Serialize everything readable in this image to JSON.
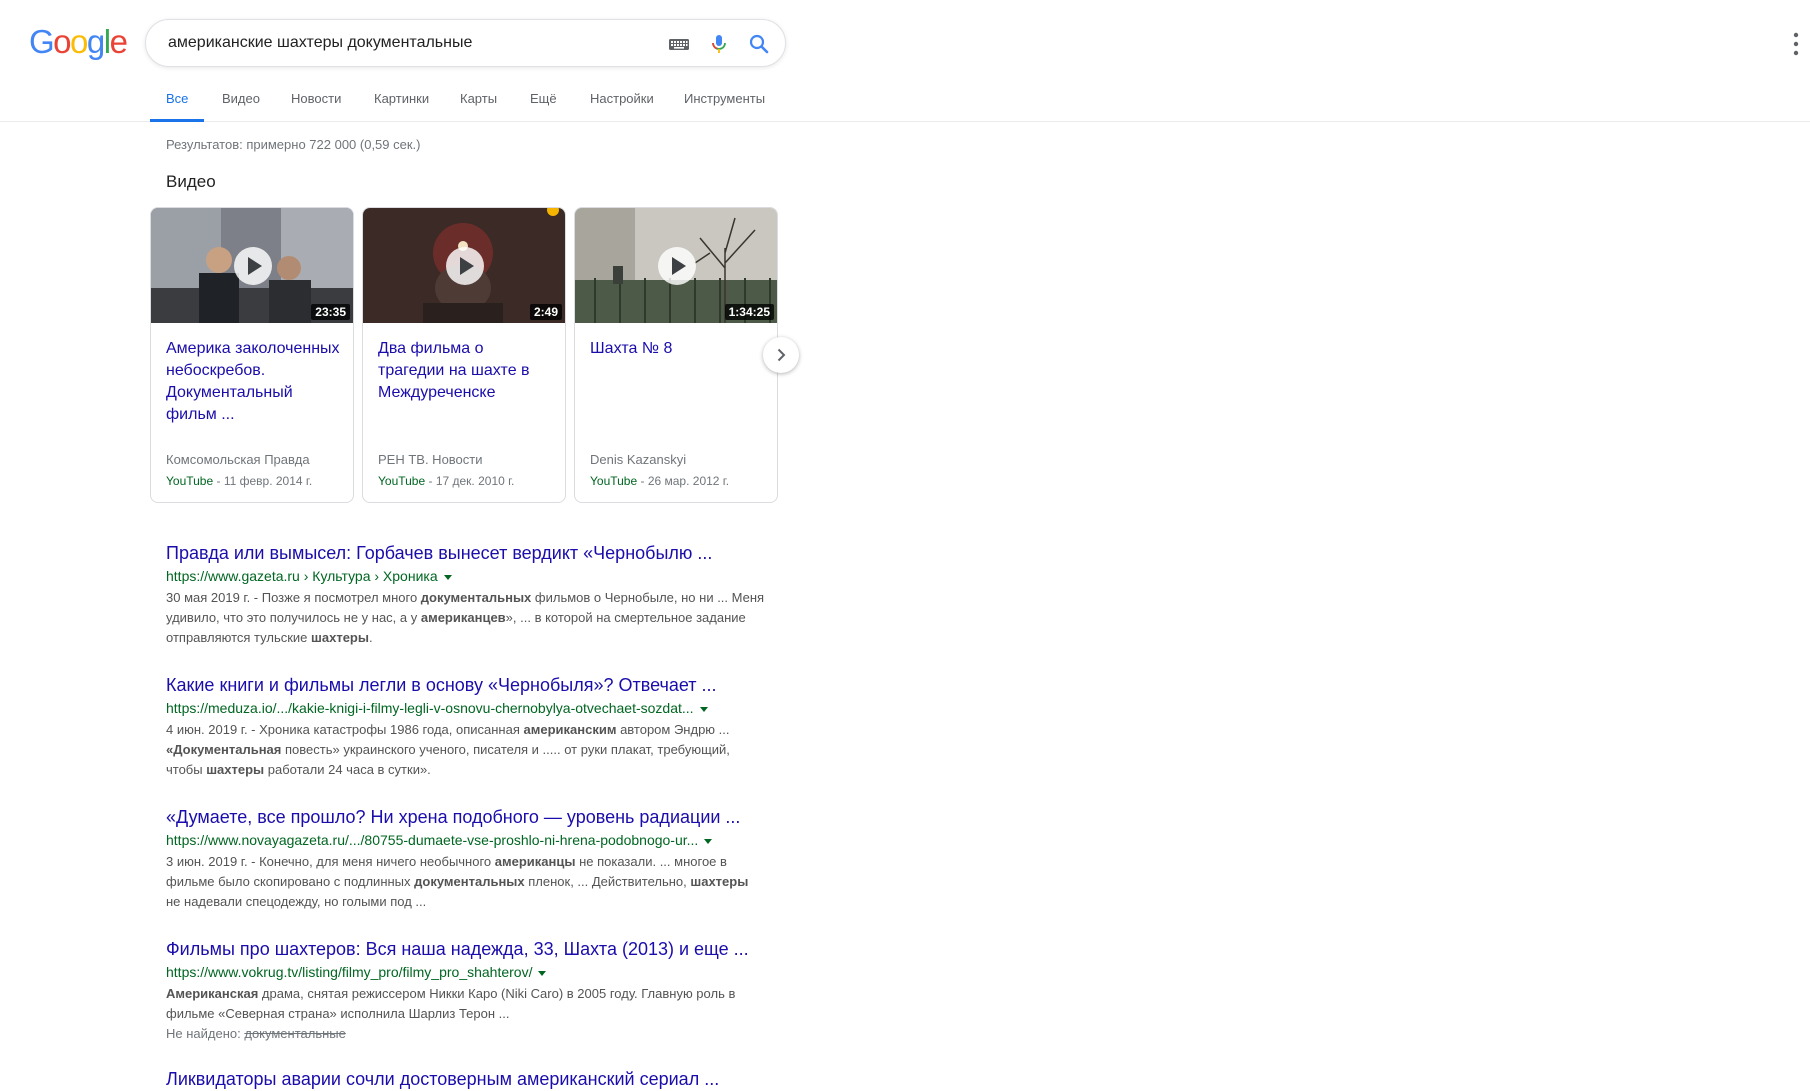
{
  "logo": {
    "letters": [
      "G",
      "o",
      "o",
      "g",
      "l",
      "e"
    ],
    "colors": [
      "#4285f4",
      "#ea4335",
      "#fbbc05",
      "#4285f4",
      "#34a853",
      "#ea4335"
    ]
  },
  "search": {
    "query": "американские шахтеры документальные"
  },
  "icons": {
    "keyboard": "keyboard-icon",
    "voice": "microphone-icon",
    "search": "search-icon",
    "apps": "apps-icon",
    "next": "chevron-right-icon"
  },
  "tabs": [
    {
      "label": "Все",
      "active": true
    },
    {
      "label": "Видео"
    },
    {
      "label": "Новости"
    },
    {
      "label": "Картинки"
    },
    {
      "label": "Карты"
    },
    {
      "label": "Ещё"
    },
    {
      "label": "Настройки"
    },
    {
      "label": "Инструменты"
    }
  ],
  "stats": "Результатов: примерно 722 000 (0,59 сек.)",
  "videos_heading": "Видео",
  "videos": [
    {
      "title": "Америка заколоченных небоскребов. Документальный фильм ...",
      "duration": "23:35",
      "source": "Комсомольская Правда",
      "site": "YouTube",
      "date": " - 11 февр. 2014 г."
    },
    {
      "title": "Два фильма о трагедии на шахте в Междуреченске",
      "duration": "2:49",
      "source": "РЕН ТВ. Новости",
      "site": "YouTube",
      "date": " - 17 дек. 2010 г."
    },
    {
      "title": "Шахта № 8",
      "duration": "1:34:25",
      "source": "Denis Kazanskyi",
      "site": "YouTube",
      "date": " - 26 мар. 2012 г."
    }
  ],
  "results": [
    {
      "title": "Правда или вымысел: Горбачев вынесет вердикт «Чернобылю ...",
      "url": "https://www.gazeta.ru › Культура › Хроника",
      "snippet": [
        {
          "t": "30 мая 2019 г. - Позже я посмотрел много "
        },
        {
          "t": "документальных",
          "b": true
        },
        {
          "t": " фильмов о Чернобыле, но ни ... Меня удивило, что это получилось не у нас, а у "
        },
        {
          "t": "американцев",
          "b": true
        },
        {
          "t": "», ... в которой на смертельное задание отправляются тульские "
        },
        {
          "t": "шахтеры",
          "b": true
        },
        {
          "t": "."
        }
      ]
    },
    {
      "title": "Какие книги и фильмы легли в основу «Чернобыля»? Отвечает ...",
      "url": "https://meduza.io/.../kakie-knigi-i-filmy-legli-v-osnovu-chernobylya-otvechaet-sozdat...",
      "snippet": [
        {
          "t": "4 июн. 2019 г. - Хроника катастрофы 1986 года, описанная "
        },
        {
          "t": "американским",
          "b": true
        },
        {
          "t": " автором Эндрю ... "
        },
        {
          "t": "«Документальная",
          "b": true
        },
        {
          "t": " повесть» украинского ученого, писателя и ..... от руки плакат, требующий, чтобы "
        },
        {
          "t": "шахтеры",
          "b": true
        },
        {
          "t": " работали 24 часа в сутки»."
        }
      ]
    },
    {
      "title": "«Думаете, все прошло? Ни хрена подобного — уровень радиации ...",
      "url": "https://www.novayagazeta.ru/.../80755-dumaete-vse-proshlo-ni-hrena-podobnogo-ur...",
      "snippet": [
        {
          "t": "3 июн. 2019 г. - Конечно, для меня ничего необычного "
        },
        {
          "t": "американцы",
          "b": true
        },
        {
          "t": " не показали. ... многое в фильме было скопировано с подлинных "
        },
        {
          "t": "документальных",
          "b": true
        },
        {
          "t": " пленок, ... Действительно, "
        },
        {
          "t": "шахтеры",
          "b": true
        },
        {
          "t": " не надевали спецодежду, но голыми под ..."
        }
      ]
    },
    {
      "title": "Фильмы про шахтеров: Вся наша надежда, 33, Шахта (2013) и еще ...",
      "url": "https://www.vokrug.tv/listing/filmy_pro/filmy_pro_shahterov/",
      "snippet": [
        {
          "t": "Американская",
          "b": true
        },
        {
          "t": " драма, снятая режиссером Никки Каро (Niki Caro) в 2005 году. Главную роль в фильме «Северная страна» исполнила Шарлиз Терон ..."
        }
      ],
      "missing_label": "Не найдено: ",
      "missing_word": "документальные"
    }
  ],
  "partial_title": "Ликвидаторы аварии сочли достоверным американский сериал ..."
}
